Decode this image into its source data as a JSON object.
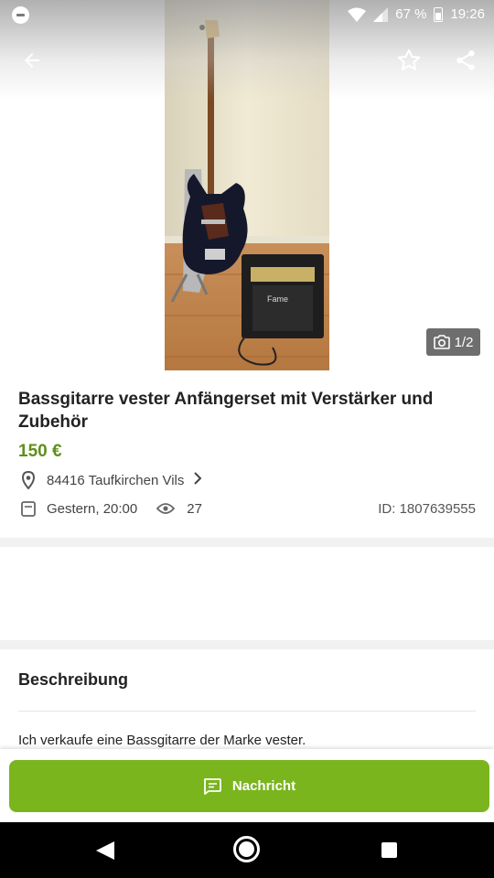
{
  "status_bar": {
    "battery_percent": "67 %",
    "time": "19:26"
  },
  "gallery": {
    "counter": "1/2"
  },
  "listing": {
    "title": "Bassgitarre vester Anfängerset mit Verstärker und Zubehör",
    "price": "150 €",
    "location": "84416 Taufkirchen Vils",
    "posted": "Gestern, 20:00",
    "views": "27",
    "ad_id": "ID: 1807639555"
  },
  "description": {
    "heading": "Beschreibung",
    "text": "Ich verkaufe eine Bassgitarre der Marke vester."
  },
  "actions": {
    "message_label": "Nachricht"
  },
  "colors": {
    "accent": "#7ab51d",
    "price": "#5f8f1b"
  },
  "icons": [
    "back-arrow-icon",
    "star-icon",
    "share-icon",
    "camera-icon",
    "location-pin-icon",
    "chevron-right-icon",
    "calendar-icon",
    "eye-icon",
    "message-icon"
  ]
}
